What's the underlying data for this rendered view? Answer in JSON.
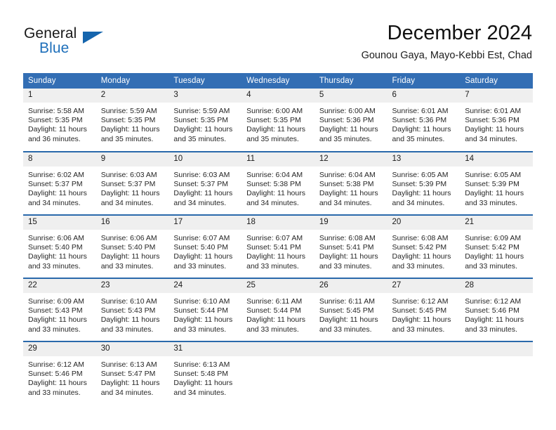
{
  "brand": {
    "name_part1": "General",
    "name_part2": "Blue",
    "triangle_color": "#1565ad",
    "blue_text_color": "#1e6fba"
  },
  "header": {
    "title": "December 2024",
    "subtitle": "Gounou Gaya, Mayo-Kebbi Est, Chad"
  },
  "theme": {
    "header_row_bg": "#336eb4",
    "day_band_bg": "#efefef",
    "row_border": "#2a69ab"
  },
  "weekday_headers": [
    "Sunday",
    "Monday",
    "Tuesday",
    "Wednesday",
    "Thursday",
    "Friday",
    "Saturday"
  ],
  "weeks": [
    [
      {
        "day": "1",
        "sunrise": "Sunrise: 5:58 AM",
        "sunset": "Sunset: 5:35 PM",
        "daylight_line1": "Daylight: 11 hours",
        "daylight_line2": "and 36 minutes."
      },
      {
        "day": "2",
        "sunrise": "Sunrise: 5:59 AM",
        "sunset": "Sunset: 5:35 PM",
        "daylight_line1": "Daylight: 11 hours",
        "daylight_line2": "and 35 minutes."
      },
      {
        "day": "3",
        "sunrise": "Sunrise: 5:59 AM",
        "sunset": "Sunset: 5:35 PM",
        "daylight_line1": "Daylight: 11 hours",
        "daylight_line2": "and 35 minutes."
      },
      {
        "day": "4",
        "sunrise": "Sunrise: 6:00 AM",
        "sunset": "Sunset: 5:35 PM",
        "daylight_line1": "Daylight: 11 hours",
        "daylight_line2": "and 35 minutes."
      },
      {
        "day": "5",
        "sunrise": "Sunrise: 6:00 AM",
        "sunset": "Sunset: 5:36 PM",
        "daylight_line1": "Daylight: 11 hours",
        "daylight_line2": "and 35 minutes."
      },
      {
        "day": "6",
        "sunrise": "Sunrise: 6:01 AM",
        "sunset": "Sunset: 5:36 PM",
        "daylight_line1": "Daylight: 11 hours",
        "daylight_line2": "and 35 minutes."
      },
      {
        "day": "7",
        "sunrise": "Sunrise: 6:01 AM",
        "sunset": "Sunset: 5:36 PM",
        "daylight_line1": "Daylight: 11 hours",
        "daylight_line2": "and 34 minutes."
      }
    ],
    [
      {
        "day": "8",
        "sunrise": "Sunrise: 6:02 AM",
        "sunset": "Sunset: 5:37 PM",
        "daylight_line1": "Daylight: 11 hours",
        "daylight_line2": "and 34 minutes."
      },
      {
        "day": "9",
        "sunrise": "Sunrise: 6:03 AM",
        "sunset": "Sunset: 5:37 PM",
        "daylight_line1": "Daylight: 11 hours",
        "daylight_line2": "and 34 minutes."
      },
      {
        "day": "10",
        "sunrise": "Sunrise: 6:03 AM",
        "sunset": "Sunset: 5:37 PM",
        "daylight_line1": "Daylight: 11 hours",
        "daylight_line2": "and 34 minutes."
      },
      {
        "day": "11",
        "sunrise": "Sunrise: 6:04 AM",
        "sunset": "Sunset: 5:38 PM",
        "daylight_line1": "Daylight: 11 hours",
        "daylight_line2": "and 34 minutes."
      },
      {
        "day": "12",
        "sunrise": "Sunrise: 6:04 AM",
        "sunset": "Sunset: 5:38 PM",
        "daylight_line1": "Daylight: 11 hours",
        "daylight_line2": "and 34 minutes."
      },
      {
        "day": "13",
        "sunrise": "Sunrise: 6:05 AM",
        "sunset": "Sunset: 5:39 PM",
        "daylight_line1": "Daylight: 11 hours",
        "daylight_line2": "and 34 minutes."
      },
      {
        "day": "14",
        "sunrise": "Sunrise: 6:05 AM",
        "sunset": "Sunset: 5:39 PM",
        "daylight_line1": "Daylight: 11 hours",
        "daylight_line2": "and 33 minutes."
      }
    ],
    [
      {
        "day": "15",
        "sunrise": "Sunrise: 6:06 AM",
        "sunset": "Sunset: 5:40 PM",
        "daylight_line1": "Daylight: 11 hours",
        "daylight_line2": "and 33 minutes."
      },
      {
        "day": "16",
        "sunrise": "Sunrise: 6:06 AM",
        "sunset": "Sunset: 5:40 PM",
        "daylight_line1": "Daylight: 11 hours",
        "daylight_line2": "and 33 minutes."
      },
      {
        "day": "17",
        "sunrise": "Sunrise: 6:07 AM",
        "sunset": "Sunset: 5:40 PM",
        "daylight_line1": "Daylight: 11 hours",
        "daylight_line2": "and 33 minutes."
      },
      {
        "day": "18",
        "sunrise": "Sunrise: 6:07 AM",
        "sunset": "Sunset: 5:41 PM",
        "daylight_line1": "Daylight: 11 hours",
        "daylight_line2": "and 33 minutes."
      },
      {
        "day": "19",
        "sunrise": "Sunrise: 6:08 AM",
        "sunset": "Sunset: 5:41 PM",
        "daylight_line1": "Daylight: 11 hours",
        "daylight_line2": "and 33 minutes."
      },
      {
        "day": "20",
        "sunrise": "Sunrise: 6:08 AM",
        "sunset": "Sunset: 5:42 PM",
        "daylight_line1": "Daylight: 11 hours",
        "daylight_line2": "and 33 minutes."
      },
      {
        "day": "21",
        "sunrise": "Sunrise: 6:09 AM",
        "sunset": "Sunset: 5:42 PM",
        "daylight_line1": "Daylight: 11 hours",
        "daylight_line2": "and 33 minutes."
      }
    ],
    [
      {
        "day": "22",
        "sunrise": "Sunrise: 6:09 AM",
        "sunset": "Sunset: 5:43 PM",
        "daylight_line1": "Daylight: 11 hours",
        "daylight_line2": "and 33 minutes."
      },
      {
        "day": "23",
        "sunrise": "Sunrise: 6:10 AM",
        "sunset": "Sunset: 5:43 PM",
        "daylight_line1": "Daylight: 11 hours",
        "daylight_line2": "and 33 minutes."
      },
      {
        "day": "24",
        "sunrise": "Sunrise: 6:10 AM",
        "sunset": "Sunset: 5:44 PM",
        "daylight_line1": "Daylight: 11 hours",
        "daylight_line2": "and 33 minutes."
      },
      {
        "day": "25",
        "sunrise": "Sunrise: 6:11 AM",
        "sunset": "Sunset: 5:44 PM",
        "daylight_line1": "Daylight: 11 hours",
        "daylight_line2": "and 33 minutes."
      },
      {
        "day": "26",
        "sunrise": "Sunrise: 6:11 AM",
        "sunset": "Sunset: 5:45 PM",
        "daylight_line1": "Daylight: 11 hours",
        "daylight_line2": "and 33 minutes."
      },
      {
        "day": "27",
        "sunrise": "Sunrise: 6:12 AM",
        "sunset": "Sunset: 5:45 PM",
        "daylight_line1": "Daylight: 11 hours",
        "daylight_line2": "and 33 minutes."
      },
      {
        "day": "28",
        "sunrise": "Sunrise: 6:12 AM",
        "sunset": "Sunset: 5:46 PM",
        "daylight_line1": "Daylight: 11 hours",
        "daylight_line2": "and 33 minutes."
      }
    ],
    [
      {
        "day": "29",
        "sunrise": "Sunrise: 6:12 AM",
        "sunset": "Sunset: 5:46 PM",
        "daylight_line1": "Daylight: 11 hours",
        "daylight_line2": "and 33 minutes."
      },
      {
        "day": "30",
        "sunrise": "Sunrise: 6:13 AM",
        "sunset": "Sunset: 5:47 PM",
        "daylight_line1": "Daylight: 11 hours",
        "daylight_line2": "and 34 minutes."
      },
      {
        "day": "31",
        "sunrise": "Sunrise: 6:13 AM",
        "sunset": "Sunset: 5:48 PM",
        "daylight_line1": "Daylight: 11 hours",
        "daylight_line2": "and 34 minutes."
      },
      {
        "day": "",
        "sunrise": "",
        "sunset": "",
        "daylight_line1": "",
        "daylight_line2": ""
      },
      {
        "day": "",
        "sunrise": "",
        "sunset": "",
        "daylight_line1": "",
        "daylight_line2": ""
      },
      {
        "day": "",
        "sunrise": "",
        "sunset": "",
        "daylight_line1": "",
        "daylight_line2": ""
      },
      {
        "day": "",
        "sunrise": "",
        "sunset": "",
        "daylight_line1": "",
        "daylight_line2": ""
      }
    ]
  ]
}
